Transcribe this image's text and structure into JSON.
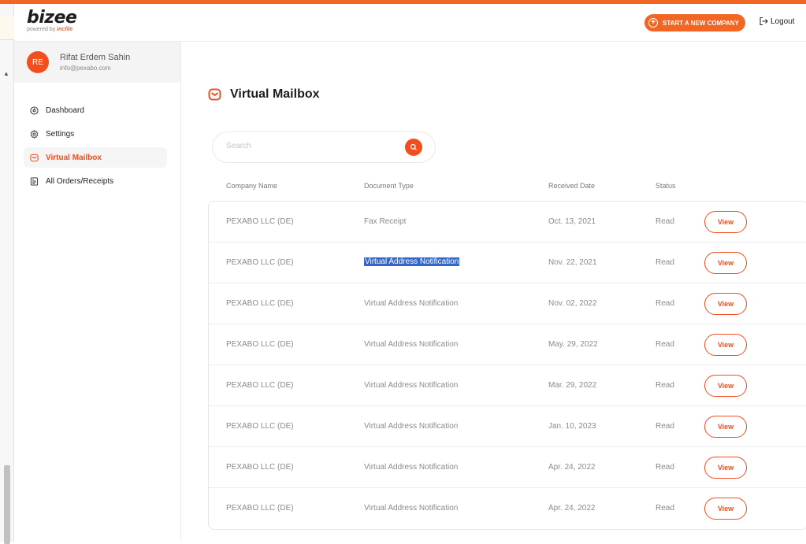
{
  "header": {
    "brand": "bizee",
    "powered_prefix": "powered by",
    "powered_brand": "incfile",
    "start_button": "START A NEW COMPANY",
    "logout": "Logout"
  },
  "user": {
    "initials": "RE",
    "name": "Rifat Erdem Sahin",
    "email": "info@pexabo.com"
  },
  "nav": [
    {
      "label": "Dashboard",
      "icon": "dashboard-icon",
      "active": false
    },
    {
      "label": "Settings",
      "icon": "gear-icon",
      "active": false
    },
    {
      "label": "Virtual Mailbox",
      "icon": "mailbox-icon",
      "active": true
    },
    {
      "label": "All Orders/Receipts",
      "icon": "receipt-icon",
      "active": false
    }
  ],
  "page": {
    "title": "Virtual Mailbox",
    "search_placeholder": "Search"
  },
  "table": {
    "headers": [
      "Company Name",
      "Document Type",
      "Received Date",
      "Status"
    ],
    "view_label": "View",
    "rows": [
      {
        "company": "PEXABO LLC (DE)",
        "doc": "Fax Receipt",
        "date": "Oct. 13, 2021",
        "status": "Read",
        "selected": false
      },
      {
        "company": "PEXABO LLC (DE)",
        "doc": "Virtual Address Notification",
        "date": "Nov. 22, 2021",
        "status": "Read",
        "selected": true
      },
      {
        "company": "PEXABO LLC (DE)",
        "doc": "Virtual Address Notification",
        "date": "Nov. 02, 2022",
        "status": "Read",
        "selected": false
      },
      {
        "company": "PEXABO LLC (DE)",
        "doc": "Virtual Address Notification",
        "date": "May. 29, 2022",
        "status": "Read",
        "selected": false
      },
      {
        "company": "PEXABO LLC (DE)",
        "doc": "Virtual Address Notification",
        "date": "Mar. 29, 2022",
        "status": "Read",
        "selected": false
      },
      {
        "company": "PEXABO LLC (DE)",
        "doc": "Virtual Address Notification",
        "date": "Jan. 10, 2023",
        "status": "Read",
        "selected": false
      },
      {
        "company": "PEXABO LLC (DE)",
        "doc": "Virtual Address Notification",
        "date": "Apr. 24, 2022",
        "status": "Read",
        "selected": false
      },
      {
        "company": "PEXABO LLC (DE)",
        "doc": "Virtual Address Notification",
        "date": "Apr. 24, 2022",
        "status": "Read",
        "selected": false
      }
    ]
  },
  "colors": {
    "accent": "#f24e1e",
    "selection": "#3366cc"
  }
}
